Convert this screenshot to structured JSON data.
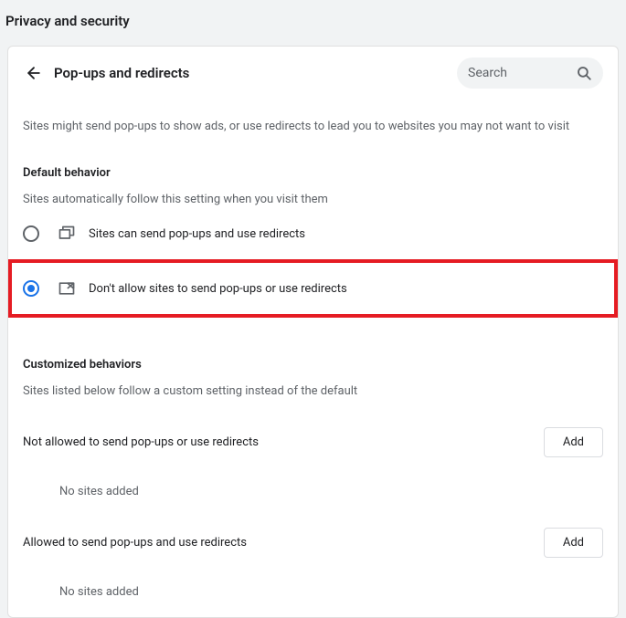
{
  "header": {
    "title": "Privacy and security"
  },
  "page": {
    "title": "Pop-ups and redirects",
    "search_placeholder": "Search",
    "description": "Sites might send pop-ups to show ads, or use redirects to lead you to websites you may not want to visit"
  },
  "default_behavior": {
    "title": "Default behavior",
    "description": "Sites automatically follow this setting when you visit them",
    "options": [
      {
        "label": "Sites can send pop-ups and use redirects",
        "selected": false
      },
      {
        "label": "Don't allow sites to send pop-ups or use redirects",
        "selected": true
      }
    ]
  },
  "customized": {
    "title": "Customized behaviors",
    "description": "Sites listed below follow a custom setting instead of the default"
  },
  "not_allowed": {
    "label": "Not allowed to send pop-ups or use redirects",
    "add": "Add",
    "empty": "No sites added"
  },
  "allowed": {
    "label": "Allowed to send pop-ups and use redirects",
    "add": "Add",
    "empty": "No sites added"
  }
}
